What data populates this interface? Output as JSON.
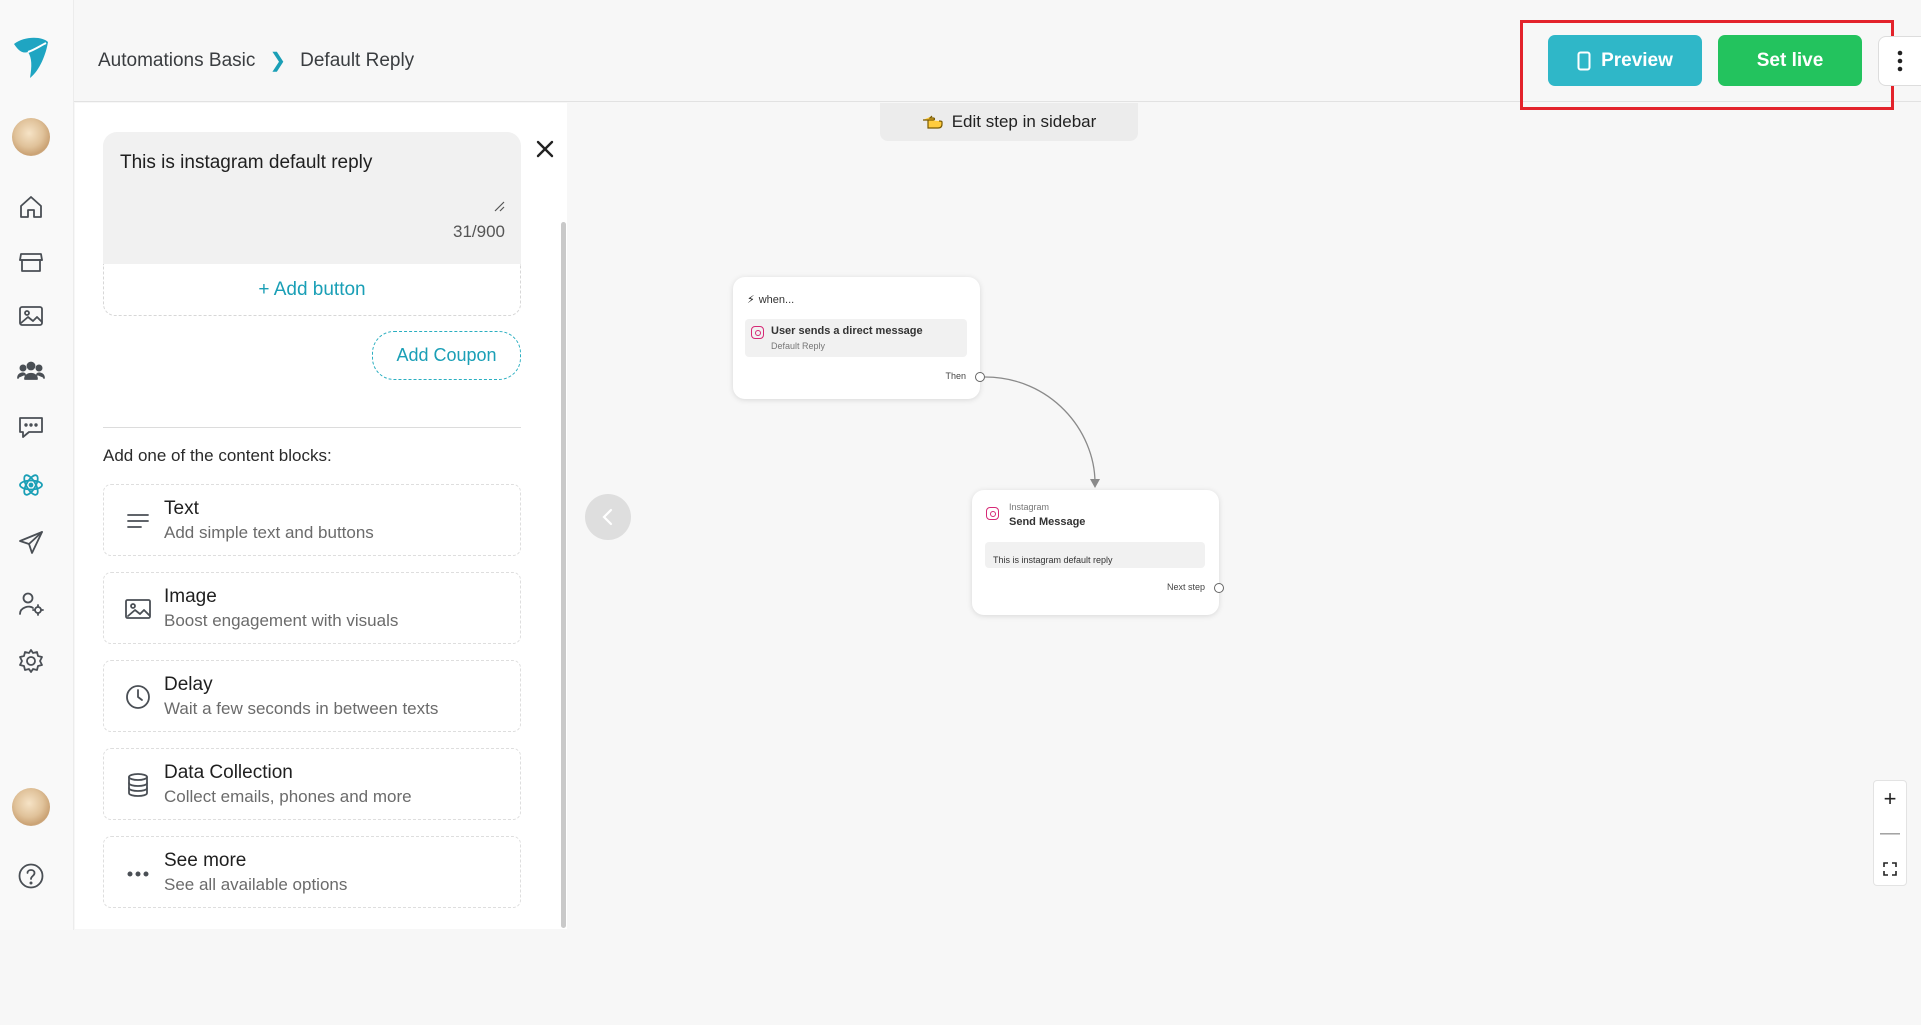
{
  "header": {
    "breadcrumb": [
      "Automations Basic",
      "Default Reply"
    ],
    "preview_label": "Preview",
    "set_live_label": "Set live"
  },
  "sidebar": {
    "message_text": "This is instagram default reply",
    "char_count": "31/900",
    "add_button_label": "+ Add button",
    "add_coupon_label": "Add Coupon",
    "blocks_title": "Add one of the content blocks:",
    "blocks": [
      {
        "title": "Text",
        "desc": "Add simple text and buttons",
        "icon": "text-lines-icon"
      },
      {
        "title": "Image",
        "desc": "Boost engagement with visuals",
        "icon": "image-icon"
      },
      {
        "title": "Delay",
        "desc": "Wait a few seconds in between texts",
        "icon": "clock-icon"
      },
      {
        "title": "Data Collection",
        "desc": "Collect emails, phones and more",
        "icon": "database-icon"
      },
      {
        "title": "See more",
        "desc": "See all available options",
        "icon": "ellipsis-icon"
      }
    ]
  },
  "canvas": {
    "edit_hint": "Edit step in sidebar",
    "trigger_node": {
      "heading": "when...",
      "trigger_title": "User sends a direct message",
      "trigger_sub": "Default Reply",
      "then_label": "Then"
    },
    "action_node": {
      "platform": "Instagram",
      "title": "Send Message",
      "message": "This is instagram default reply",
      "next_label": "Next step"
    }
  },
  "colors": {
    "accent": "#1a9fb6",
    "preview": "#2fb7c8",
    "set_live": "#23c35e",
    "highlight": "#e3232b"
  }
}
